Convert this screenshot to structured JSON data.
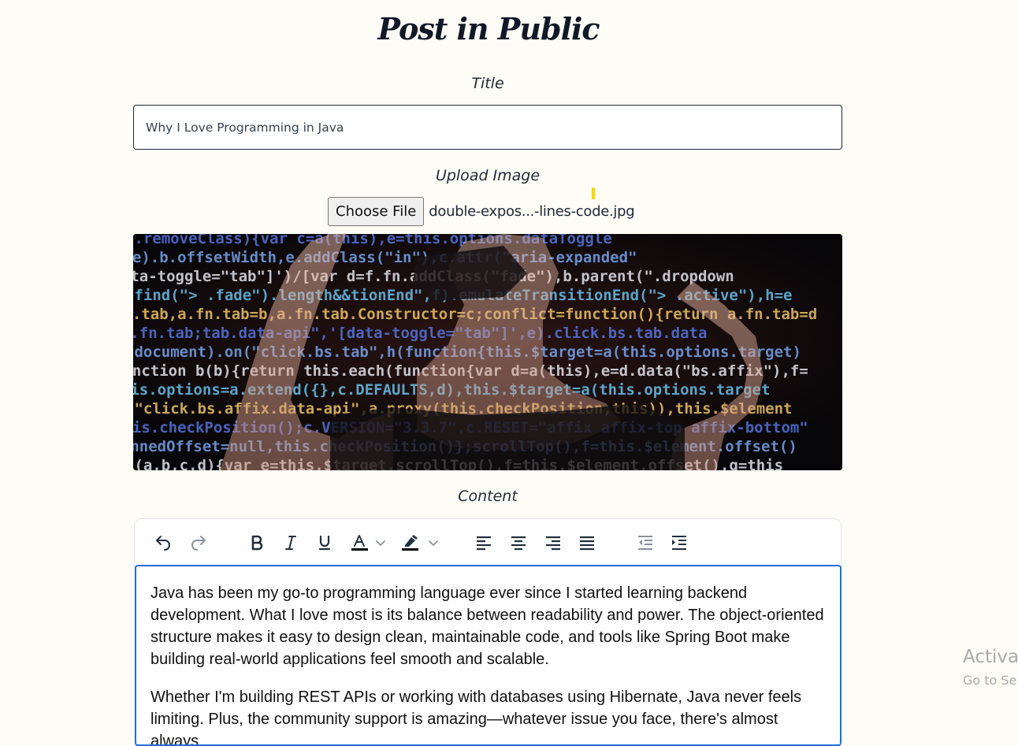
{
  "page": {
    "title": "Post in Public"
  },
  "form": {
    "title_label": "Title",
    "title_value": "Why I Love Programming in Java",
    "image_label": "Upload Image",
    "choose_file_label": "Choose File",
    "file_name": "double-expos...-lines-code.jpg",
    "image_alt": "Person wearing VR headset with lines of code projected",
    "content_label": "Content"
  },
  "image_code_lines": [
    "}.removeClass){var c=a(this),e=this.options.dataToggle",
    "/,e).b.offsetWidth,e.addClass(\"in\"),c.attr(\"aria-expanded\"",
    "[data-toggle=\"tab\"]')/[var d=f.fn.addClass(\"fade\"),b.parent(\".dropdown",
    ".find(\"> .fade\").length&&tionEnd\",f).emulateTransitionEnd(\"> .active\"),h=e",
    "fn.tab,a.fn.tab=b,a.fn.tab.Constructor=c;conflict=function(){return a.fn.tab=d",
    "c=a.fn.tab;tab.data-api\",'[data-toggle=\"tab\"]',e).click.bs.tab.data",
    "(document).on(\"click.bs.tab\",h(function{this.$target=a(this.options.target)",
    "function b(b){return this.each(function{var d=a(this),e=d.data(\"bs.affix\"),f=",
    "[this.options=a.extend({},c.DEFAULTS,d),this.$target=a(this.options.target",
    "(\"click.bs.affix.data-api\",a.proxy(this.checkPosition,this)),this.$element",
    "this.checkPosition();c.VERSION=\"3.3.7\",c.RESET=\"affix affix-top affix-bottom\"",
    "nPinnedOffset=null,this.checkPosition()};scrollTop(),f=this.$element.offset()",
    "c(a,b,c,d){var e=this.$target.scrollTop(),f=this.$element.offset(),g=this"
  ],
  "toolbar": {
    "buttons": [
      {
        "name": "undo-button",
        "icon": "undo-icon"
      },
      {
        "name": "redo-button",
        "icon": "redo-icon"
      },
      {
        "name": "bold-button",
        "icon": "bold-icon"
      },
      {
        "name": "italic-button",
        "icon": "italic-icon"
      },
      {
        "name": "underline-button",
        "icon": "underline-icon"
      },
      {
        "name": "text-color-button",
        "icon": "text-color-icon"
      },
      {
        "name": "highlight-color-button",
        "icon": "highlighter-icon"
      },
      {
        "name": "align-left-button",
        "icon": "align-left-icon"
      },
      {
        "name": "align-center-button",
        "icon": "align-center-icon"
      },
      {
        "name": "align-right-button",
        "icon": "align-right-icon"
      },
      {
        "name": "justify-button",
        "icon": "align-justify-icon"
      },
      {
        "name": "outdent-button",
        "icon": "outdent-icon"
      },
      {
        "name": "indent-button",
        "icon": "indent-icon"
      }
    ],
    "colors": {
      "icon": "#222f3e",
      "disabled": "#8a9199",
      "swatch": "#000000"
    }
  },
  "editor": {
    "paragraphs": [
      "Java has been my go-to programming language ever since I started learning backend development. What I love most is its balance between readability and power. The object-oriented structure makes it easy to design clean, maintainable code, and tools like Spring Boot make building real-world applications feel smooth and scalable.",
      "Whether I'm building REST APIs or working with databases using Hibernate, Java never feels limiting. Plus, the community support is amazing—whatever issue you face, there's almost always"
    ],
    "focus_color": "#1d6fd8"
  },
  "watermark": {
    "line1": "Activat",
    "line2": "Go to Se"
  }
}
